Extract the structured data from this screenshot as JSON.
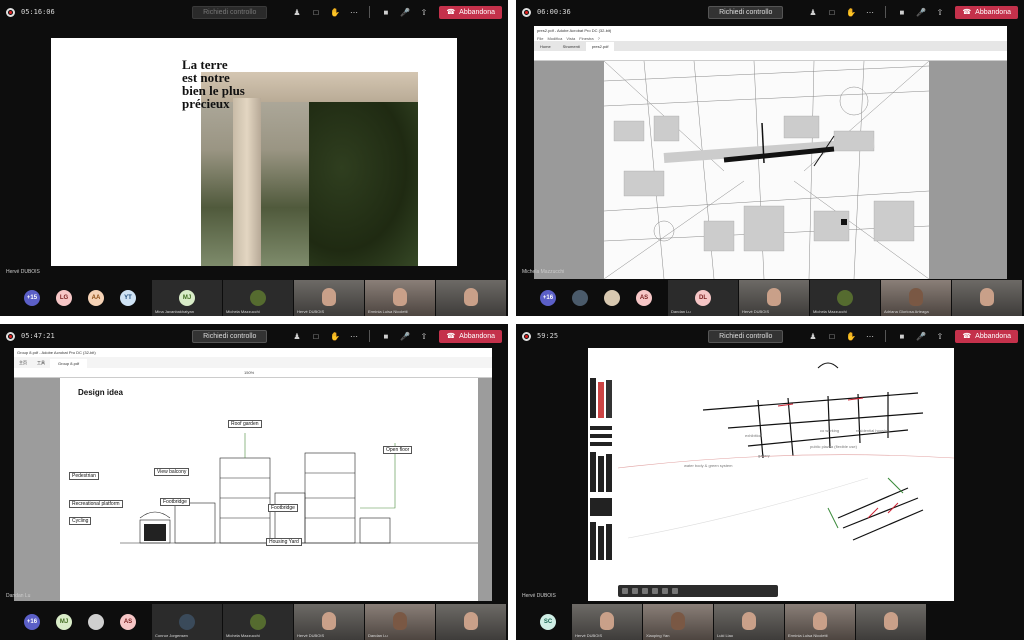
{
  "quadrants": [
    {
      "timer": "05:16:06",
      "control_label": "Richiedi controllo",
      "control_disabled": true,
      "leave_label": "Abbandona",
      "presenter": "Hervé DUBOIS",
      "slide_title": [
        "La terre",
        "est notre",
        "bien le plus",
        "précieux"
      ],
      "more_count": "+15",
      "participants": [
        {
          "initials": "LG",
          "bg": "#f6c6c6",
          "fg": "#7a2020"
        },
        {
          "initials": "AA",
          "bg": "#f5d2b5",
          "fg": "#8a4a10"
        },
        {
          "initials": "YT",
          "bg": "#cfe3f5",
          "fg": "#1d4a7a"
        }
      ],
      "tiles": [
        {
          "initials": "MJ",
          "name": "Mina Javanbakhatyan",
          "bg": "#d9ecc8",
          "fg": "#3f6b1e"
        },
        {
          "name": "Michela Mazzucchi",
          "type": "logo"
        },
        {
          "name": "Hervé DUBOIS",
          "type": "video"
        },
        {
          "name": "Erminia Luisa Nicoletti",
          "type": "video2"
        },
        {
          "name": "",
          "type": "video"
        }
      ]
    },
    {
      "timer": "06:00:36",
      "control_label": "Richiedi controllo",
      "leave_label": "Abbandona",
      "presenter": "Michela Mazzucchi",
      "window_title": "pres2.pdf - Adobe Acrobat Pro DC (32-bit)",
      "menu": [
        "File",
        "Modifica",
        "Vista",
        "Finestra",
        "?"
      ],
      "tabs": [
        "Home",
        "Strumenti",
        "pres2.pdf"
      ],
      "more_count": "+16",
      "participants": [
        {
          "initials": "AS",
          "bg": "#f6c6c6",
          "fg": "#7a2020"
        }
      ],
      "tiles": [
        {
          "initials": "DL",
          "name": "Dandan Lu",
          "bg": "#f6c6c6",
          "fg": "#7a2020"
        },
        {
          "name": "Hervé DUBOIS",
          "type": "video"
        },
        {
          "name": "Michela Mazzucchi",
          "type": "logo"
        },
        {
          "name": "Adriana Gloriosa Arteaga",
          "type": "video2"
        },
        {
          "name": "",
          "type": "video"
        }
      ]
    },
    {
      "timer": "05:47:21",
      "control_label": "Richiedi controllo",
      "leave_label": "Abbandona",
      "presenter": "Dandan Lu",
      "window_title": "Group 8.pdf - Adobe Acrobat Pro DC (32-bit)",
      "tabs": [
        "主页",
        "工具",
        "Group 8.pdf"
      ],
      "zoom": "150%",
      "design_title": "Design idea",
      "labels": {
        "roof": "Roof garden",
        "open": "Open floor",
        "ped": "Pedestrian",
        "view": "View balcony",
        "rec": "Recreational platform",
        "foot1": "Footbridge",
        "foot2": "Footbridge",
        "cyc": "Cycling",
        "yard": "Housing Yard"
      },
      "more_count": "+16",
      "participants": [
        {
          "initials": "MJ",
          "bg": "#d9ecc8",
          "fg": "#3f6b1e"
        },
        {
          "initials": "",
          "bg": "#cfcfcf",
          "fg": "#333"
        },
        {
          "initials": "AS",
          "bg": "#f6c6c6",
          "fg": "#7a2020"
        }
      ],
      "tiles": [
        {
          "name": "Connor Jorgensen",
          "type": "video"
        },
        {
          "name": "Michela Mazzucchi",
          "type": "logo"
        },
        {
          "name": "Hervé DUBOIS",
          "type": "video"
        },
        {
          "name": "Dandan Lu",
          "type": "video2"
        },
        {
          "name": "",
          "type": "video"
        }
      ]
    },
    {
      "timer": "59:25",
      "control_label": "Richiedi controllo",
      "leave_label": "Abbandona",
      "presenter": "Hervé DUBOIS",
      "wb_notes": {
        "exhibition": "exhibition",
        "coworking": "co working",
        "housing": "residential housing",
        "gallery": "gallery",
        "piazza": "public piazza (flexible use)",
        "water": "water body & green system"
      },
      "more_count": "",
      "participants": [
        {
          "initials": "SC",
          "bg": "#cfeee5",
          "fg": "#1d6a56"
        }
      ],
      "tiles": [
        {
          "name": "Hervé DUBOIS",
          "type": "video"
        },
        {
          "name": "Xiaoping Yan",
          "type": "video2"
        },
        {
          "name": "Luki Liao",
          "type": "video"
        },
        {
          "name": "Erminia Luisa Nicoletti",
          "type": "video2"
        },
        {
          "name": "",
          "type": "video"
        }
      ]
    }
  ]
}
